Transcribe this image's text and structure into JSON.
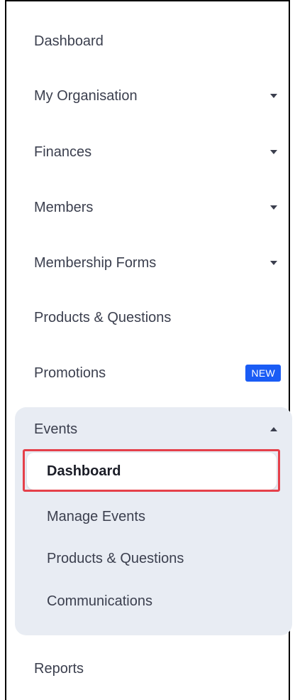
{
  "nav": {
    "items": [
      {
        "label": "Dashboard"
      },
      {
        "label": "My Organisation"
      },
      {
        "label": "Finances"
      },
      {
        "label": "Members"
      },
      {
        "label": "Membership Forms"
      },
      {
        "label": "Products & Questions"
      },
      {
        "label": "Promotions",
        "badge": "NEW"
      }
    ],
    "events": {
      "label": "Events",
      "expanded": true,
      "subitems": [
        {
          "label": "Dashboard",
          "active": true
        },
        {
          "label": "Manage Events"
        },
        {
          "label": "Products & Questions"
        },
        {
          "label": "Communications"
        }
      ]
    },
    "reports": {
      "label": "Reports"
    }
  },
  "colors": {
    "text": "#3b3f4e",
    "badge_bg": "#1a5cf5",
    "panel_bg": "#e8ecf3",
    "highlight": "#e5404a"
  },
  "icons": {
    "dropdown": "caret-down-icon",
    "collapse": "caret-up-icon"
  }
}
